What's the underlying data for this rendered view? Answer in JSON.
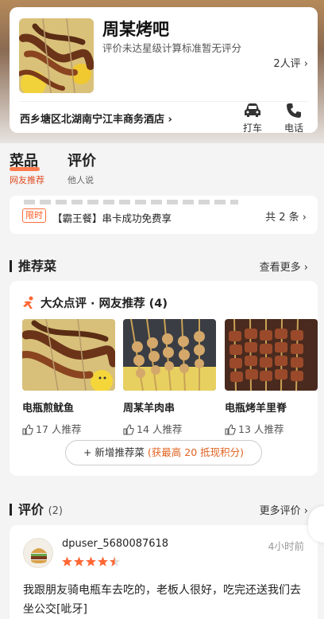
{
  "shop": {
    "name": "周某烤吧",
    "rating_note": "评价未达星级计算标准暂无评分",
    "review_count": "2人评",
    "address": "西乡塘区北湖南宁江丰商务酒店",
    "actions": [
      {
        "label": "打车",
        "icon": "car-icon"
      },
      {
        "label": "电话",
        "icon": "phone-icon"
      }
    ]
  },
  "tabs": [
    {
      "title": "菜品",
      "sub": "网友推荐",
      "active": true
    },
    {
      "title": "评价",
      "sub": "他人说",
      "active": false
    }
  ],
  "promo": {
    "badge": "限时",
    "text": "【霸王餐】串卡成功免费享",
    "total": "共 2 条"
  },
  "recommended": {
    "section_title": "推荐菜",
    "more": "查看更多",
    "card_title": "大众点评 · 网友推荐 (4)",
    "dishes": [
      {
        "name": "电瓶煎鱿鱼",
        "recommend": "17 人推荐"
      },
      {
        "name": "周某羊肉串",
        "recommend": "14 人推荐"
      },
      {
        "name": "电瓶烤羊里脊",
        "recommend": "13 人推荐"
      }
    ],
    "add_button": {
      "prefix": "新增推荐菜",
      "highlight": "(获最高 20 抵现积分)"
    }
  },
  "reviews": {
    "section_title": "评价",
    "count": "(2)",
    "more": "更多评价",
    "items": [
      {
        "user": "dpuser_5680087618",
        "time": "4小时前",
        "stars": 4.5,
        "text": "我跟朋友骑电瓶车去吃的，老板人很好，吃完还送我们去坐公交[呲牙]"
      }
    ]
  },
  "colors": {
    "accent": "#ff6d3b",
    "star": "#ff6633",
    "brand_dp": "#ff6633"
  }
}
